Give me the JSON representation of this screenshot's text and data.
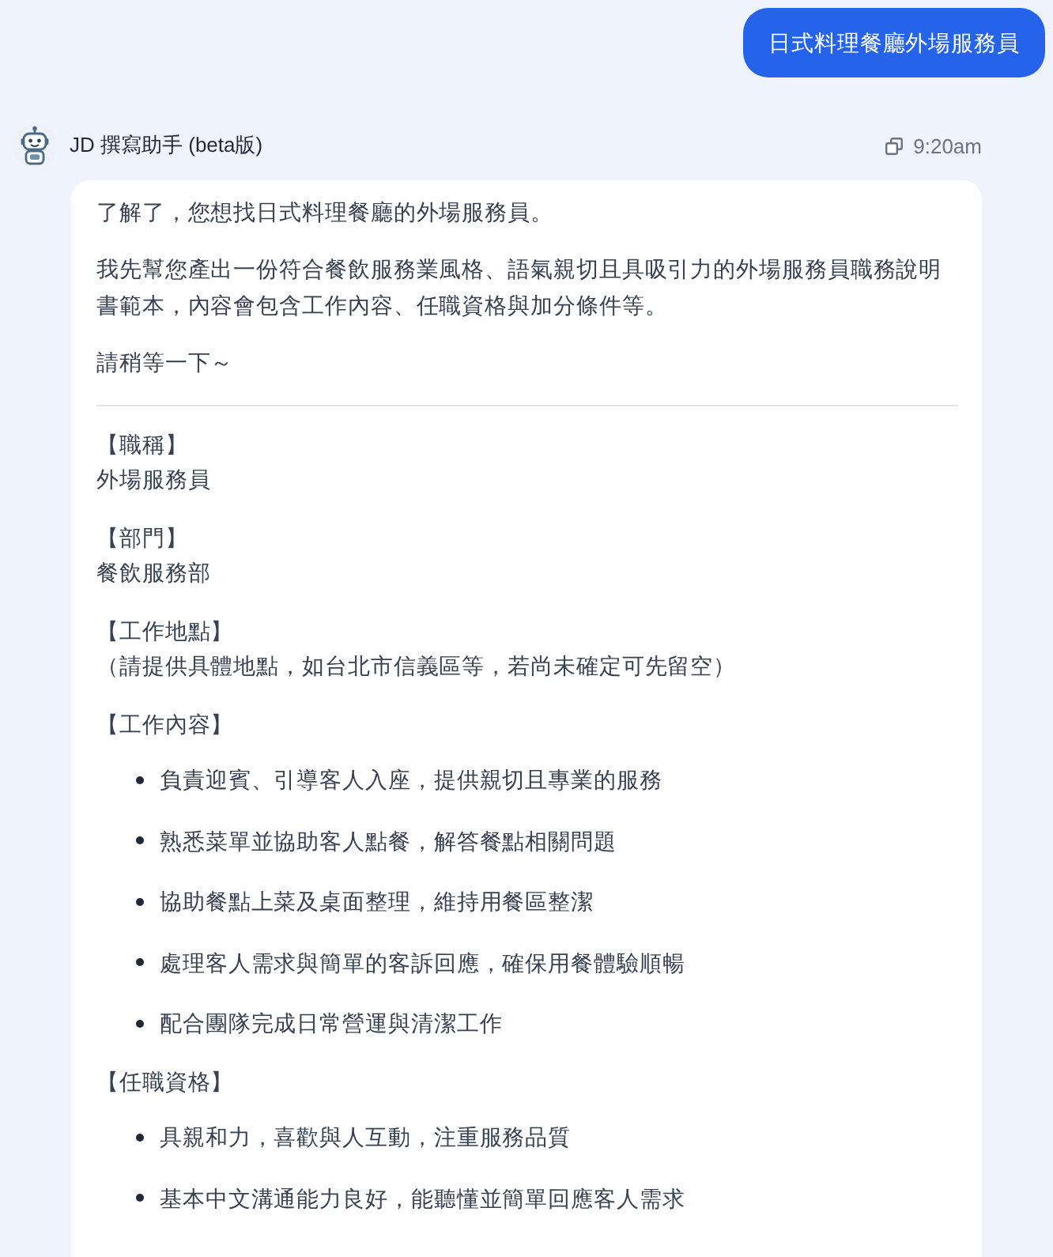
{
  "user_message": {
    "text": "日式料理餐廳外場服務員"
  },
  "assistant_message": {
    "sender": "JD 撰寫助手 (beta版)",
    "time": "9:20am",
    "intro": [
      "了解了，您想找日式料理餐廳的外場服務員。",
      "我先幫您產出一份符合餐飲服務業風格、語氣親切且具吸引力的外場服務員職務說明書範本，內容會包含工作內容、任職資格與加分條件等。",
      "請稍等一下～"
    ],
    "sections": [
      {
        "kind": "text",
        "heading": "【職稱】",
        "text": "外場服務員"
      },
      {
        "kind": "text",
        "heading": "【部門】",
        "text": "餐飲服務部"
      },
      {
        "kind": "text",
        "heading": "【工作地點】",
        "text": "（請提供具體地點，如台北市信義區等，若尚未確定可先留空）"
      },
      {
        "kind": "list",
        "heading": "【工作內容】",
        "items": [
          "負責迎賓、引導客人入座，提供親切且專業的服務",
          "熟悉菜單並協助客人點餐，解答餐點相關問題",
          "協助餐點上菜及桌面整理，維持用餐區整潔",
          "處理客人需求與簡單的客訴回應，確保用餐體驗順暢",
          "配合團隊完成日常營運與清潔工作"
        ]
      },
      {
        "kind": "list",
        "heading": "【任職資格】",
        "items": [
          "具親和力，喜歡與人互動，注重服務品質",
          "基本中文溝通能力良好，能聽懂並簡單回應客人需求"
        ]
      }
    ]
  }
}
